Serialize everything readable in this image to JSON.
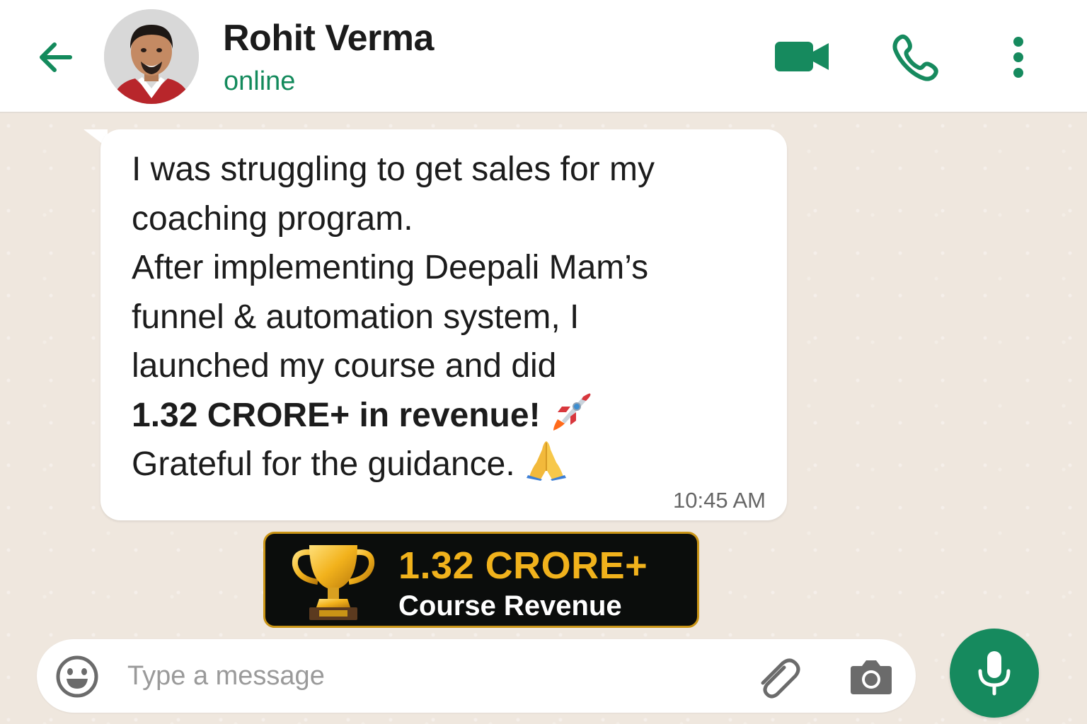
{
  "header": {
    "contact_name": "Rohit Verma",
    "status": "online",
    "back_icon": "arrow-left-icon",
    "video_icon": "video-camera-icon",
    "call_icon": "phone-icon",
    "menu_icon": "more-vertical-icon"
  },
  "message": {
    "lines": [
      "I was struggling to get sales for my",
      "coaching program.",
      "After implementing Deepali Mam’s",
      "funnel & automation system, I",
      "launched my course and did"
    ],
    "highlight": "1.32 CRORE+ in revenue!",
    "closing": "Grateful for the guidance.",
    "time": "10:45 AM",
    "emojis": [
      "rocket-emoji",
      "folded-hands-emoji"
    ]
  },
  "badge": {
    "amount": "1.32 CRORE+",
    "label": "Course Revenue",
    "icon": "trophy-icon"
  },
  "composer": {
    "placeholder": "Type a message",
    "icons": [
      "smiley-icon",
      "paperclip-icon",
      "camera-icon",
      "microphone-icon"
    ]
  },
  "colors": {
    "accent": "#168a5e",
    "status_green": "#138a5c",
    "badge_gold": "#f1b21c",
    "badge_bg": "#0b0d0c",
    "chat_bg": "#efe7de"
  }
}
